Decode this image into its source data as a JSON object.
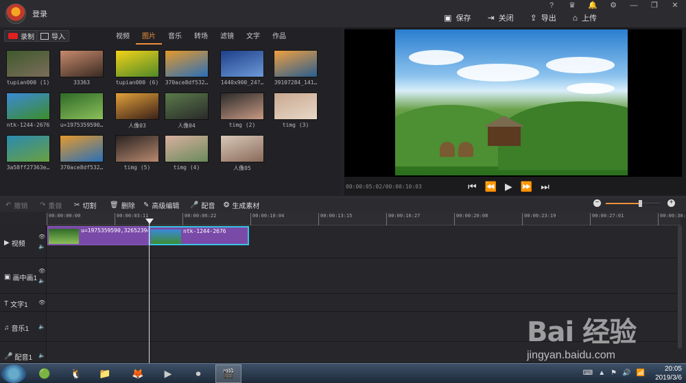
{
  "titlebar": {
    "login": "登录",
    "window_controls": [
      "?",
      "♛",
      "🔔",
      "⚙",
      "—",
      "❐",
      "✕"
    ],
    "actions": [
      {
        "icon": "save-icon",
        "glyph": "▣",
        "label": "保存"
      },
      {
        "icon": "close-doc-icon",
        "glyph": "⇥",
        "label": "关闭"
      },
      {
        "icon": "export-icon",
        "glyph": "⇪",
        "label": "导出"
      },
      {
        "icon": "upload-icon",
        "glyph": "⌂",
        "label": "上传"
      }
    ]
  },
  "library": {
    "record_label": "录制",
    "import_label": "导入",
    "tabs": [
      "视频",
      "图片",
      "音乐",
      "转场",
      "滤镜",
      "文字",
      "作品"
    ],
    "active_tab": "图片",
    "items": [
      {
        "caption": "tupian000 (1)",
        "colors": [
          "#3f5a2e",
          "#7b6d5a"
        ]
      },
      {
        "caption": "33363",
        "colors": [
          "#c78a6d",
          "#3a2a22"
        ]
      },
      {
        "caption": "tupian000 (6)",
        "colors": [
          "#f3d21a",
          "#4f8a28"
        ]
      },
      {
        "caption": "370ace8df532…",
        "colors": [
          "#e59a2c",
          "#2a6fb8"
        ]
      },
      {
        "caption": "1440x900_24?…",
        "colors": [
          "#1e3f8a",
          "#6c9ad8"
        ]
      },
      {
        "caption": "39107284_141…",
        "colors": [
          "#f0a040",
          "#2a5d8f"
        ]
      },
      {
        "caption": "ntk-1244-2676",
        "colors": [
          "#3b8ad8",
          "#3c8c2a"
        ]
      },
      {
        "caption": "u=1975359590…",
        "colors": [
          "#2e6a28",
          "#8cbf5a"
        ]
      },
      {
        "caption": "人像03",
        "colors": [
          "#e2a13a",
          "#3a2018"
        ]
      },
      {
        "caption": "人像04",
        "colors": [
          "#5a7a4a",
          "#2a2a2a"
        ]
      },
      {
        "caption": "timg (2)",
        "colors": [
          "#2a2a2a",
          "#c99a84"
        ]
      },
      {
        "caption": "timg (3)",
        "colors": [
          "#c9a890",
          "#e8d8c8"
        ]
      },
      {
        "caption": "3a58ff27363e…",
        "colors": [
          "#2a8ab0",
          "#6aa040"
        ]
      },
      {
        "caption": "370ace8df532…",
        "colors": [
          "#e59a2c",
          "#2a6fb8"
        ]
      },
      {
        "caption": "timg (5)",
        "colors": [
          "#2a2220",
          "#b88a70"
        ]
      },
      {
        "caption": "timg (4)",
        "colors": [
          "#d8b0a0",
          "#6a8a5a"
        ]
      },
      {
        "caption": "人像05",
        "colors": [
          "#d8c8b8",
          "#8a6a5a"
        ]
      }
    ]
  },
  "preview": {
    "timecode": "00:00:05:02/00:00:10:03",
    "controls": [
      "⏮",
      "⏪",
      "▶",
      "⏩",
      "⏭"
    ]
  },
  "editbar": {
    "undo": "撤销",
    "redo": "重做",
    "cut": "切割",
    "delete": "删除",
    "advanced": "高级编辑",
    "dub": "配音",
    "generate": "生成素材",
    "zoom_level": 0.63
  },
  "timeline": {
    "ticks": [
      "00:00:00:00",
      "00:00:03:11",
      "00:00:06:22",
      "00:00:10:04",
      "00:00:13:15",
      "00:00:16:27",
      "00:00:20:08",
      "00:00:23:19",
      "00:00:27:01",
      "00:00:30:…"
    ],
    "tracks": [
      {
        "label": "视频",
        "icon": "video-track-icon",
        "glyph": "▶"
      },
      {
        "label": "画中画1",
        "icon": "pip-track-icon",
        "glyph": "▣"
      },
      {
        "label": "文字1",
        "icon": "text-track-icon",
        "glyph": "T"
      },
      {
        "label": "音乐1",
        "icon": "music-track-icon",
        "glyph": "♫"
      },
      {
        "label": "配音1",
        "icon": "mic-track-icon",
        "glyph": "🎤"
      }
    ],
    "clips": [
      {
        "label": "u=1975359590,3265239468",
        "colors": [
          "#2e6a28",
          "#8cbf5a"
        ]
      },
      {
        "label": "ntk-1244-2676",
        "colors": [
          "#3b8ad8",
          "#3c8c2a"
        ]
      }
    ]
  },
  "taskbar": {
    "time": "20:05",
    "date": "2019/3/6"
  },
  "watermark": {
    "brand": "Bai 经验",
    "url": "jingyan.baidu.com"
  }
}
